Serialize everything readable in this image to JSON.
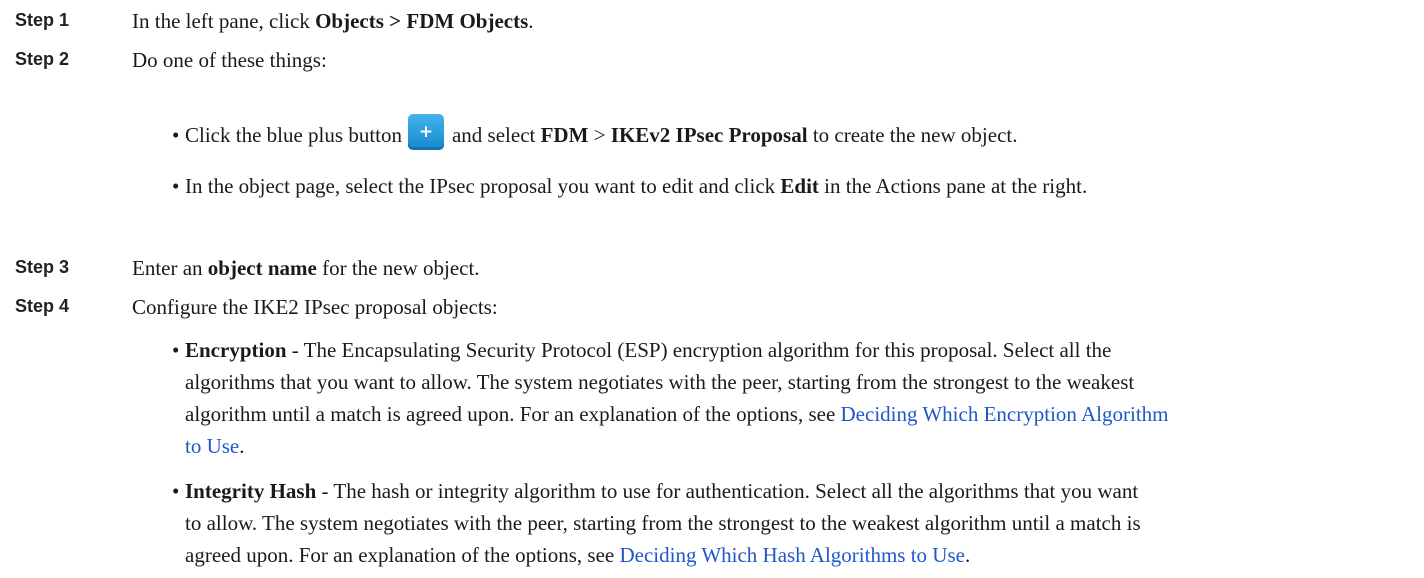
{
  "steps": [
    {
      "label": "Step 1",
      "pre": "In the left pane, click ",
      "bold": "Objects > FDM Objects",
      "post": "."
    },
    {
      "label": "Step 2",
      "text": "Do one of these things:"
    },
    {
      "label": "Step 3",
      "pre": "Enter an ",
      "bold": "object name",
      "post": " for the new object."
    },
    {
      "label": "Step 4",
      "text": "Configure the IKE2 IPsec proposal objects:"
    }
  ],
  "step2_bullets": {
    "b1": {
      "pre": "Click the blue plus button",
      "mid": "and select ",
      "bold1": "FDM",
      "sep": " > ",
      "bold2": "IKEv2 IPsec Proposal",
      "post": " to create the new object."
    },
    "b2": {
      "pre": "In the object page, select the IPsec proposal you want to edit and click ",
      "bold": "Edit",
      "post": " in the Actions pane at the right."
    }
  },
  "step4_bullets": {
    "encryption": {
      "term": "Encryption",
      "line1": " - The Encapsulating Security Protocol (ESP) encryption algorithm for this proposal. Select all the",
      "line2": "algorithms that you want to allow. The system negotiates with the peer, starting from the strongest to the weakest",
      "line3": "algorithm until a match is agreed upon. For an explanation of the options, see ",
      "link_a": "Deciding Which Encryption Algorithm",
      "link_b": "to Use",
      "end": "."
    },
    "integrity": {
      "term": "Integrity Hash",
      "line1": " - The hash or integrity algorithm to use for authentication. Select all the algorithms that you want",
      "line2": "to allow. The system negotiates with the peer, starting from the strongest to the weakest algorithm until a match is",
      "line3": "agreed upon. For an explanation of the options, see ",
      "link": "Deciding Which Hash Algorithms to Use",
      "end": "."
    }
  },
  "bullet_glyph": "•",
  "icons": {
    "plus_button": "plus-icon"
  },
  "colors": {
    "link": "#1f57c9",
    "plus_button": "#2a9fe0"
  }
}
